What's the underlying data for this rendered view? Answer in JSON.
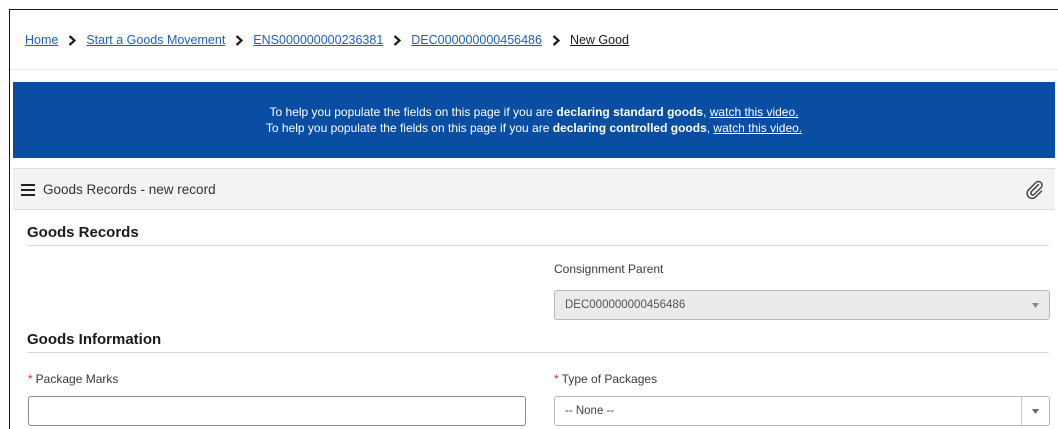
{
  "breadcrumb": {
    "items": [
      {
        "label": "Home"
      },
      {
        "label": "Start a Goods Movement"
      },
      {
        "label": "ENS000000000236381"
      },
      {
        "label": "DEC000000000456486"
      },
      {
        "label": "New Good"
      }
    ]
  },
  "banner": {
    "line1_prefix": "To help you populate the fields on this page if you are ",
    "line1_bold": "declaring standard goods",
    "line1_sep": ", ",
    "line1_link": "watch this video.",
    "line2_prefix": "To help you populate the fields on this page if you are ",
    "line2_bold": "declaring controlled goods",
    "line2_sep": ", ",
    "line2_link": "watch this video."
  },
  "panel": {
    "title": "Goods Records - new record",
    "menu_icon": "hamburger-menu-icon",
    "attach_icon": "paperclip-icon"
  },
  "goods_records": {
    "title": "Goods Records",
    "consignment_parent_label": "Consignment Parent",
    "consignment_parent_value": "DEC000000000456486"
  },
  "goods_information": {
    "title": "Goods Information",
    "required_marker": "*",
    "package_marks_label": "Package Marks",
    "package_marks_value": "",
    "type_of_packages_label": "Type of Packages",
    "type_of_packages_value": "-- None --"
  },
  "colors": {
    "banner_bg": "#0a4ea3",
    "link": "#1f5fbf",
    "required": "#c23934"
  }
}
